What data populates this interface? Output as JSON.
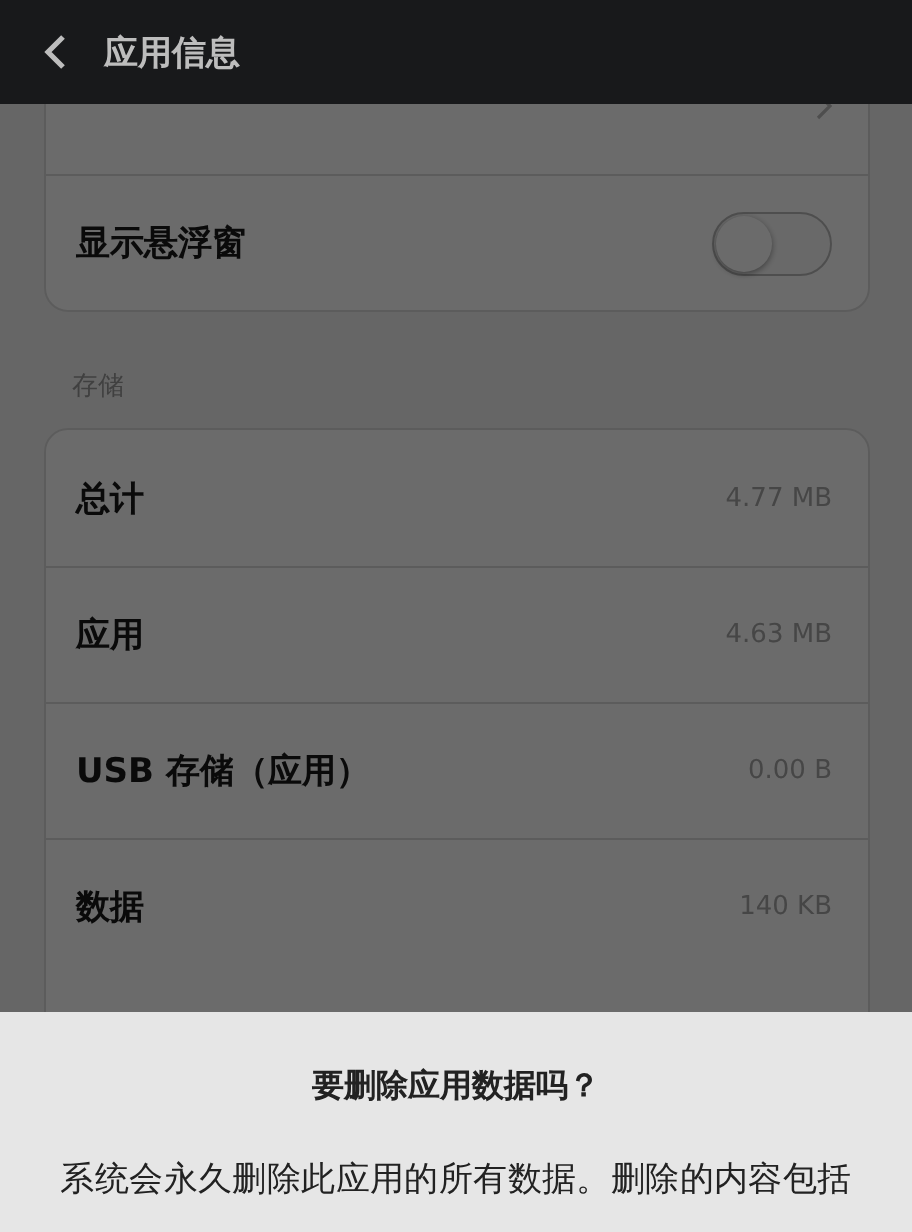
{
  "header": {
    "title": "应用信息"
  },
  "sections": [
    {
      "rows": [
        {
          "kind": "link"
        },
        {
          "kind": "toggle",
          "label": "显示悬浮窗",
          "on": false
        }
      ]
    },
    {
      "heading": "存储",
      "rows": [
        {
          "kind": "value",
          "label": "总计",
          "value": "4.77 MB"
        },
        {
          "kind": "value",
          "label": "应用",
          "value": "4.63 MB"
        },
        {
          "kind": "value",
          "label": "USB 存储（应用）",
          "value": "0.00 B"
        },
        {
          "kind": "value",
          "label": "数据",
          "value": "140 KB"
        }
      ]
    }
  ],
  "dialog": {
    "title": "要删除应用数据吗？",
    "message": "系统会永久删除此应用的所有数据。删除的内容包括"
  }
}
